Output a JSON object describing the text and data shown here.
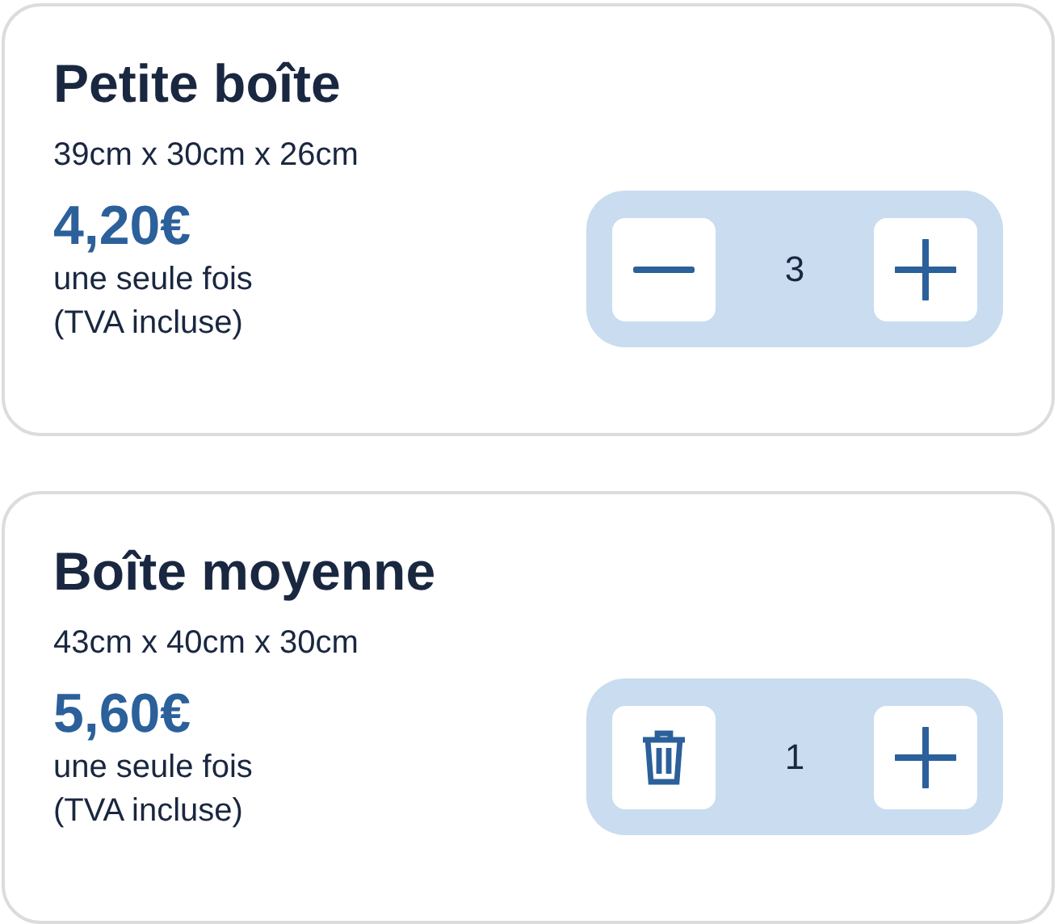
{
  "products": [
    {
      "title": "Petite boîte",
      "dimensions": "39cm x 30cm x 26cm",
      "price": "4,20€",
      "note_lines": [
        "une seule fois",
        "(TVA incluse)"
      ],
      "quantity": "3",
      "decrement": {
        "kind": "minus"
      }
    },
    {
      "title": "Boîte moyenne",
      "dimensions": "43cm x 40cm x 30cm",
      "price": "5,60€",
      "note_lines": [
        "une seule fois",
        "(TVA incluse)"
      ],
      "quantity": "1",
      "decrement": {
        "kind": "trash"
      }
    }
  ]
}
